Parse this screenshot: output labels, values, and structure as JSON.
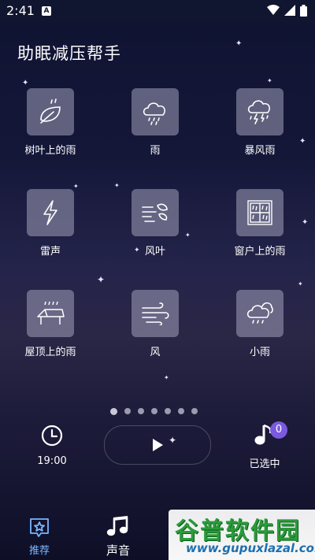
{
  "status_bar": {
    "time": "2:41",
    "notification_letter": "A"
  },
  "app": {
    "title": "助眠减压帮手"
  },
  "sounds": [
    {
      "label": "树叶上的雨",
      "icon": "leaf-rain-icon"
    },
    {
      "label": "雨",
      "icon": "cloud-rain-icon"
    },
    {
      "label": "暴风雨",
      "icon": "storm-cloud-icon"
    },
    {
      "label": "雷声",
      "icon": "lightning-icon"
    },
    {
      "label": "风叶",
      "icon": "wind-leaves-icon"
    },
    {
      "label": "窗户上的雨",
      "icon": "window-rain-icon"
    },
    {
      "label": "屋顶上的雨",
      "icon": "roof-rain-icon"
    },
    {
      "label": "风",
      "icon": "wind-icon"
    },
    {
      "label": "小雨",
      "icon": "light-rain-cloud-icon"
    }
  ],
  "pagination": {
    "count": 7,
    "active_index": 0
  },
  "controls": {
    "timer_label": "19:00",
    "selected_label": "已选中",
    "selected_count": "0"
  },
  "bottom_nav": {
    "items": [
      {
        "label": "推荐",
        "icon": "star-card-icon",
        "active": true
      },
      {
        "label": "声音",
        "icon": "music-note-icon",
        "active": false
      }
    ]
  },
  "watermark": {
    "main": "谷普软件园",
    "sub": "www.gupuxlazal.com"
  },
  "colors": {
    "accent": "#7a5ae0",
    "nav_active": "#7ab7ff"
  }
}
